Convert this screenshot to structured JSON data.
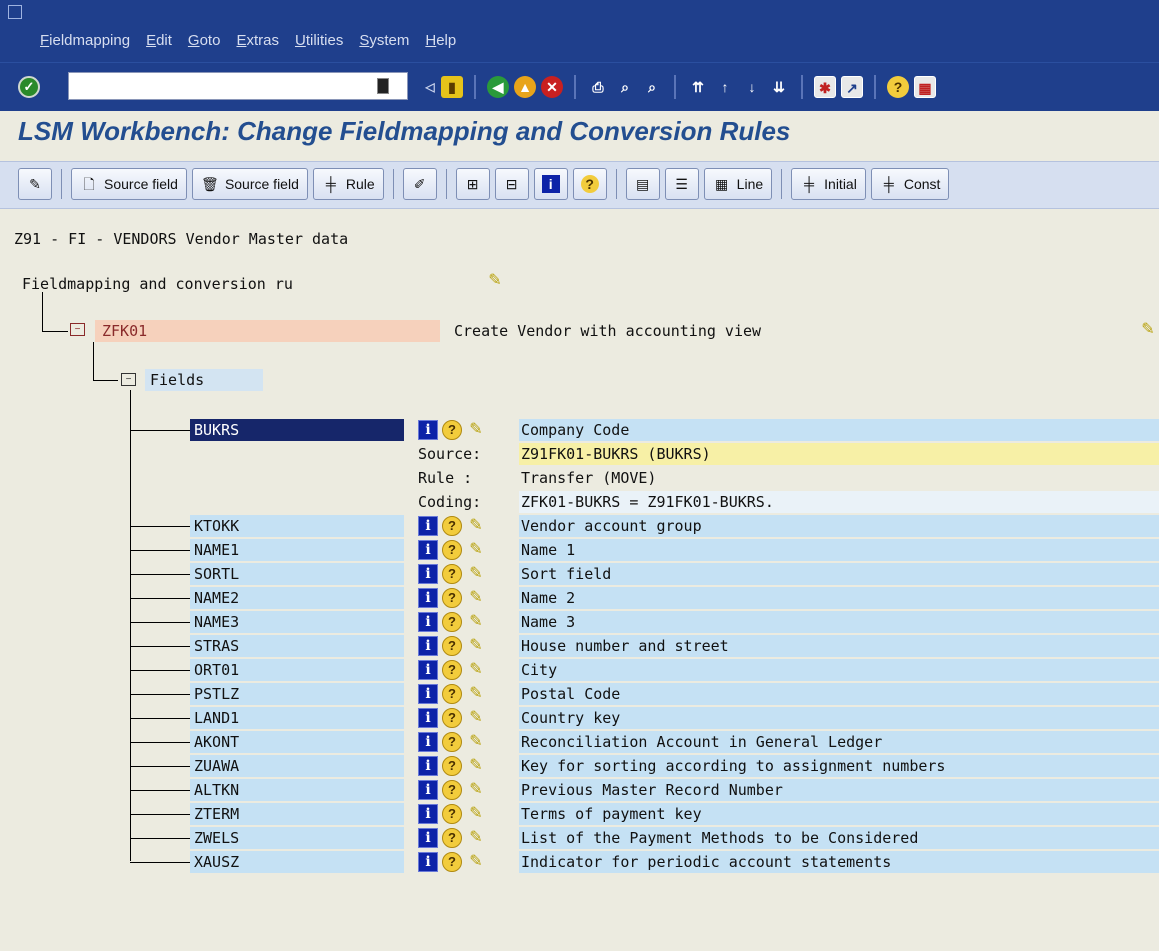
{
  "menu": [
    "Fieldmapping",
    "Edit",
    "Goto",
    "Extras",
    "Utilities",
    "System",
    "Help"
  ],
  "toolbar": {
    "command_value": "",
    "icons": [
      "enter-icon",
      "save-icon",
      "back-icon",
      "exit-icon",
      "cancel-icon",
      "print-icon",
      "find-icon",
      "find-next-icon",
      "first-page-icon",
      "prev-page-icon",
      "next-page-icon",
      "last-page-icon",
      "create-session-icon",
      "shortcut-icon",
      "help-icon",
      "layout-icon"
    ]
  },
  "title": "LSM Workbench: Change Fieldmapping and Conversion Rules",
  "app_toolbar": {
    "source_field_create": "Source field",
    "source_field_delete": "Source field",
    "rule": "Rule",
    "line": "Line",
    "initial": "Initial",
    "const": "Const"
  },
  "object_title": "Z91 - FI - VENDORS Vendor Master data",
  "root_label": "Fieldmapping and conversion ru",
  "structure": {
    "name": "ZFK01",
    "description": "Create Vendor with accounting view"
  },
  "fields_node": "Fields",
  "details": {
    "source_label": "Source:",
    "source_value": "Z91FK01-BUKRS (BUKRS)",
    "rule_label": "Rule :",
    "rule_value": "Transfer (MOVE)",
    "coding_label": "Coding:",
    "coding_value": "ZFK01-BUKRS = Z91FK01-BUKRS."
  },
  "fields": [
    {
      "name": "BUKRS",
      "desc": "Company Code"
    },
    {
      "name": "KTOKK",
      "desc": "Vendor account group"
    },
    {
      "name": "NAME1",
      "desc": "Name 1"
    },
    {
      "name": "SORTL",
      "desc": "Sort field"
    },
    {
      "name": "NAME2",
      "desc": "Name 2"
    },
    {
      "name": "NAME3",
      "desc": "Name 3"
    },
    {
      "name": "STRAS",
      "desc": "House number and street"
    },
    {
      "name": "ORT01",
      "desc": "City"
    },
    {
      "name": "PSTLZ",
      "desc": "Postal Code"
    },
    {
      "name": "LAND1",
      "desc": "Country key"
    },
    {
      "name": "AKONT",
      "desc": "Reconciliation Account in General Ledger"
    },
    {
      "name": "ZUAWA",
      "desc": "Key for sorting according to assignment numbers"
    },
    {
      "name": "ALTKN",
      "desc": "Previous Master Record Number"
    },
    {
      "name": "ZTERM",
      "desc": "Terms of payment key"
    },
    {
      "name": "ZWELS",
      "desc": "List of the Payment Methods to be Considered"
    },
    {
      "name": "XAUSZ",
      "desc": "Indicator for periodic account statements"
    }
  ]
}
